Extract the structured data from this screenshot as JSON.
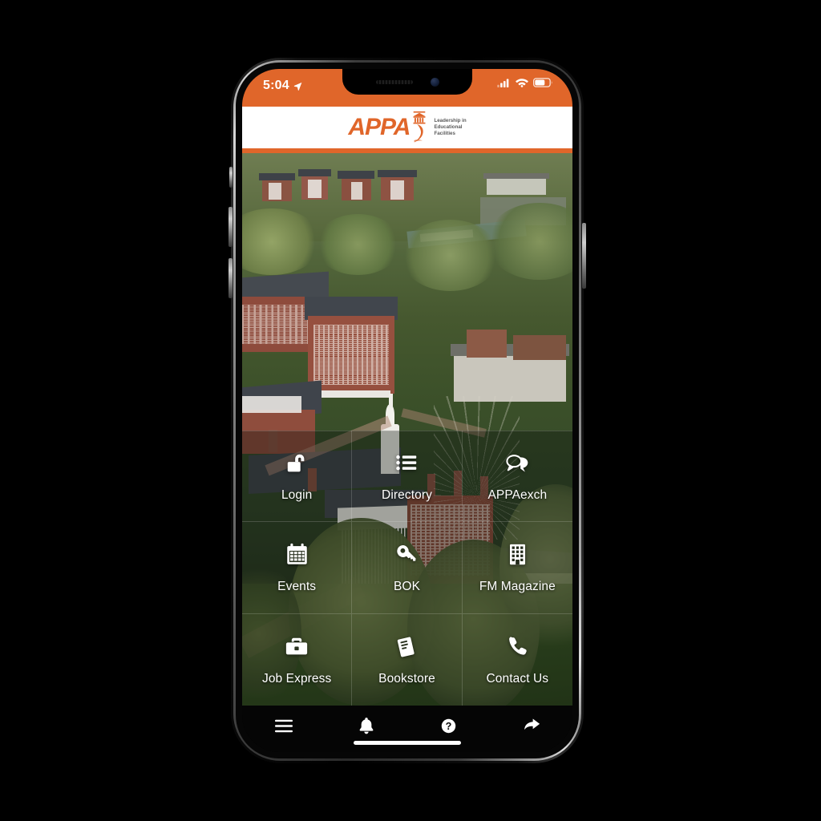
{
  "status_bar": {
    "time": "5:04",
    "location_icon": "location-arrow-icon",
    "cellular_icon": "cellular-signal-icon",
    "wifi_icon": "wifi-icon",
    "battery_icon": "battery-icon",
    "background_color": "#E0662A",
    "text_color": "#FFFFFF"
  },
  "header": {
    "logo_text": "APPA",
    "tagline_line1": "Leadership in",
    "tagline_line2": "Educational",
    "tagline_line3": "Facilities",
    "logo_icon": "appa-building-logo-icon",
    "brand_color": "#E0662A",
    "background_color": "#FFFFFF"
  },
  "hero": {
    "alt": "aerial-campus-photo"
  },
  "menu": {
    "items": [
      {
        "label": "Login",
        "icon": "unlock-icon"
      },
      {
        "label": "Directory",
        "icon": "list-icon"
      },
      {
        "label": "APPAexch",
        "icon": "chat-bubbles-icon"
      },
      {
        "label": "Events",
        "icon": "calendar-icon"
      },
      {
        "label": "BOK",
        "icon": "key-icon"
      },
      {
        "label": "FM Magazine",
        "icon": "building-icon"
      },
      {
        "label": "Job Express",
        "icon": "briefcase-icon"
      },
      {
        "label": "Bookstore",
        "icon": "book-icon"
      },
      {
        "label": "Contact Us",
        "icon": "phone-icon"
      }
    ]
  },
  "toolbar": {
    "items": [
      {
        "name": "menu",
        "icon": "hamburger-menu-icon"
      },
      {
        "name": "notifications",
        "icon": "bell-icon"
      },
      {
        "name": "help",
        "icon": "question-mark-icon"
      },
      {
        "name": "share",
        "icon": "share-arrow-icon"
      }
    ],
    "background_color": "#050505"
  }
}
